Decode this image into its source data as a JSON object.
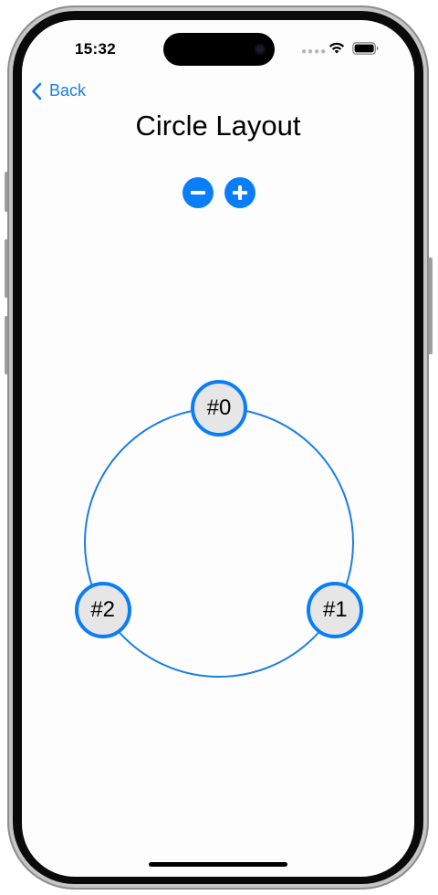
{
  "status_bar": {
    "time": "15:32"
  },
  "nav": {
    "back_label": "Back"
  },
  "page": {
    "title": "Circle Layout"
  },
  "stepper": {
    "decrement_icon": "minus-circle-icon",
    "increment_icon": "plus-circle-icon"
  },
  "layout": {
    "nodes": [
      {
        "label": "#0"
      },
      {
        "label": "#1"
      },
      {
        "label": "#2"
      }
    ]
  },
  "colors": {
    "accent": "#0a7ef8",
    "link": "#1a7ee6",
    "node_fill": "#e6e6e6"
  }
}
